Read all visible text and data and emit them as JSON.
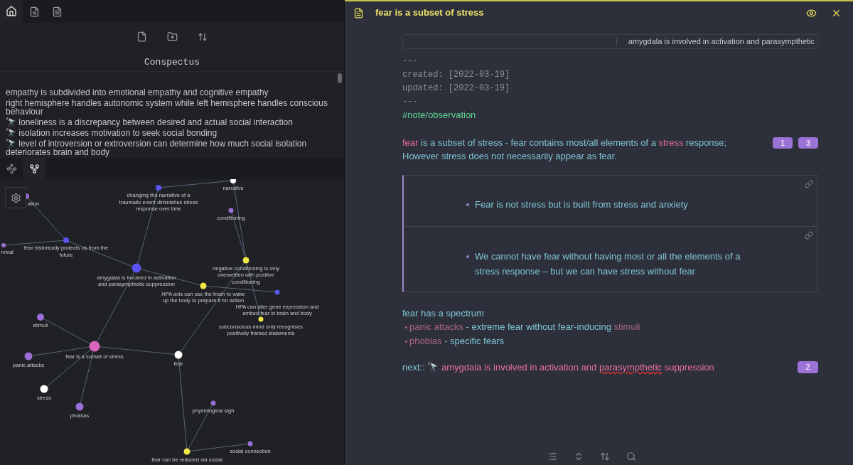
{
  "sidebar_tabs": [
    {
      "kind": "home",
      "selected": true
    },
    {
      "kind": "search",
      "selected": false
    },
    {
      "kind": "outline",
      "selected": false
    }
  ],
  "file_explorer": {
    "title": "Conspectus",
    "items": [
      "empathy is subdivided into emotional empathy and cognitive empathy",
      "right hemisphere handles autonomic system while left hemisphere handles conscious behaviour",
      "🔭 loneliness is a discrepancy between desired and actual social interaction",
      "🔭 isolation increases motivation to seek social bonding",
      "🔭 level of introversion or extroversion can determine how much social isolation deteriorates brain and body"
    ]
  },
  "graph_tabs": [
    {
      "kind": "global",
      "selected": false
    },
    {
      "kind": "local",
      "selected": true
    }
  ],
  "graph": {
    "nodes": [
      {
        "label": [
          "ation"
        ],
        "color": "#9b6fd8"
      },
      {
        "label": [
          "changing the narrative of a",
          "traumatic event diminishes stress",
          "response over time"
        ],
        "color": "#5a55f0"
      },
      {
        "label": [
          "narrative"
        ],
        "color": "#ffffff"
      },
      {
        "label": [
          "conditioning"
        ],
        "color": "#9b6fd8"
      },
      {
        "label": [
          "rvival"
        ],
        "color": "#9b6fd8"
      },
      {
        "label": [
          "fear historically protects us from the",
          "future"
        ],
        "color": "#5a55f0"
      },
      {
        "label": [
          "amygdala is involved in activation",
          "and parasympthetic suppression"
        ],
        "color": "#5a55f0"
      },
      {
        "label": [
          "negative conditioning is only",
          "overwritten with positive",
          "conditioning"
        ],
        "color": "#f0e846"
      },
      {
        "label": [
          "HPA axis can use the brain to wake",
          "up the body to prepare it for action"
        ],
        "color": "#f0e846"
      },
      {
        "label": [
          "HPA can alter gene expression and",
          "embed fear in brain and body"
        ],
        "color": "#5a55f0"
      },
      {
        "label": [
          "subconscious mind only recognises",
          "positively framed statements"
        ],
        "color": "#f0e846"
      },
      {
        "label": [
          "stimuli"
        ],
        "color": "#9b6fd8"
      },
      {
        "label": [
          "fear is a subset of stress"
        ],
        "color": "#d965bd"
      },
      {
        "label": [
          "panic attacks"
        ],
        "color": "#9b6fd8"
      },
      {
        "label": [
          "fear"
        ],
        "color": "#ffffff"
      },
      {
        "label": [
          "stress"
        ],
        "color": "#ffffff"
      },
      {
        "label": [
          "phobias"
        ],
        "color": "#9b6fd8"
      },
      {
        "label": [
          "physiological sigh"
        ],
        "color": "#9b6fd8"
      },
      {
        "label": [
          "social connection"
        ],
        "color": "#9b6fd8"
      },
      {
        "label": [
          "fear can be reduced via social"
        ],
        "color": "#f0e846"
      }
    ]
  },
  "note": {
    "title": "fear is a subset of stress",
    "breadcrumb": "amygdala is involved in activation and parasympthetic",
    "frontmatter": [
      "---",
      "created: [2022-03-19]",
      "updated: [2022-03-19]",
      "---"
    ],
    "tag": "#note/observation",
    "paragraph": {
      "segments": [
        {
          "text": "fear",
          "kind": "link"
        },
        {
          "text": " is a subset of stress - fear contains most/all elements of a ",
          "kind": "plain"
        },
        {
          "text": "stress",
          "kind": "link"
        },
        {
          "text": " response; However stress does not necessarily appear as fear.",
          "kind": "plain"
        }
      ],
      "badges": [
        "1",
        "3"
      ]
    },
    "embeds": [
      "Fear is not stress but is built from stress and anxiety",
      "We cannot have fear without having most or all the elements of a stress response – but we can have stress without fear"
    ],
    "spectrum": {
      "heading": "fear has a spectrum",
      "bullets": [
        [
          {
            "text": "panic attacks",
            "kind": "dim-link"
          },
          {
            "text": " -  extreme fear without fear-inducing ",
            "kind": "plain"
          },
          {
            "text": "stimuli",
            "kind": "dim-link"
          }
        ],
        [
          {
            "text": "phobias",
            "kind": "dim-link"
          },
          {
            "text": " - specific fears",
            "kind": "plain"
          }
        ]
      ]
    },
    "next": {
      "segments": [
        {
          "text": "next:: 🔭",
          "kind": "plain",
          "misspelled": false
        },
        {
          "text": " amygdala is involved in activation and ",
          "kind": "link",
          "misspelled": false
        },
        {
          "text": "parasympthetic",
          "kind": "link",
          "misspelled": true
        },
        {
          "text": " suppression",
          "kind": "link",
          "misspelled": false
        }
      ],
      "badges": [
        "2"
      ]
    }
  }
}
